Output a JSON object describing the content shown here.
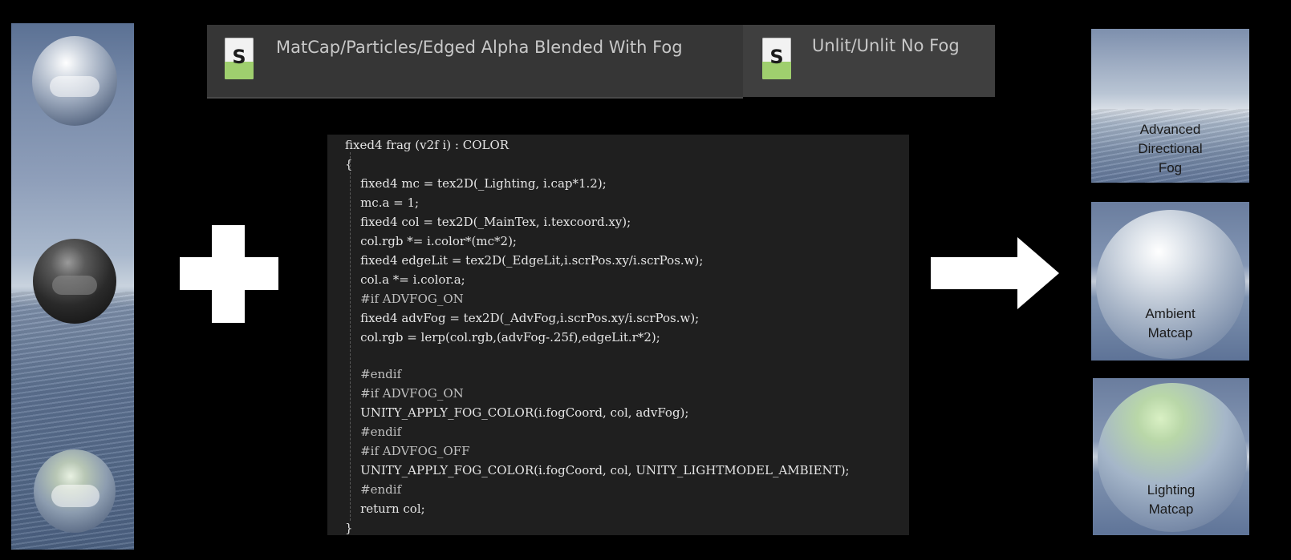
{
  "tabs": [
    {
      "icon": "shader-file-icon",
      "icon_glyph": "S",
      "label": "MatCap/Particles/Edged Alpha Blended With Fog"
    },
    {
      "icon": "shader-file-icon",
      "icon_glyph": "S",
      "label": "Unlit/Unlit No Fog"
    }
  ],
  "code": {
    "lines": [
      "fixed4 frag (v2f i) : COLOR",
      "{",
      "    fixed4 mc = tex2D(_Lighting, i.cap*1.2);",
      "    mc.a = 1;",
      "    fixed4 col = tex2D(_MainTex, i.texcoord.xy);",
      "    col.rgb *= i.color*(mc*2);",
      "    fixed4 edgeLit = tex2D(_EdgeLit,i.scrPos.xy/i.scrPos.w);",
      "    col.a *= i.color.a;",
      "    #if ADVFOG_ON",
      "    fixed4 advFog = tex2D(_AdvFog,i.scrPos.xy/i.scrPos.w);",
      "    col.rgb = lerp(col.rgb,(advFog-.25f),edgeLit.r*2);",
      "",
      "    #endif",
      "    #if ADVFOG_ON",
      "    UNITY_APPLY_FOG_COLOR(i.fogCoord, col, advFog);",
      "    #endif",
      "    #if ADVFOG_OFF",
      "    UNITY_APPLY_FOG_COLOR(i.fogCoord, col, UNITY_LIGHTMODEL_AMBIENT);",
      "    #endif",
      "    return col;",
      "}"
    ]
  },
  "previews": [
    {
      "label_lines": [
        "Advanced",
        "Directional",
        "Fog"
      ]
    },
    {
      "label_lines": [
        "Ambient",
        "Matcap"
      ]
    },
    {
      "label_lines": [
        "Lighting",
        "Matcap"
      ]
    }
  ],
  "symbols": {
    "plus": "plus-icon",
    "arrow": "arrow-right-icon"
  },
  "colors": {
    "background": "#000000",
    "tab_bg": "#3d3d3d",
    "code_bg": "#1f1f1f",
    "code_text": "#e6e6e6",
    "shader_icon_green": "#9fcf6e"
  }
}
